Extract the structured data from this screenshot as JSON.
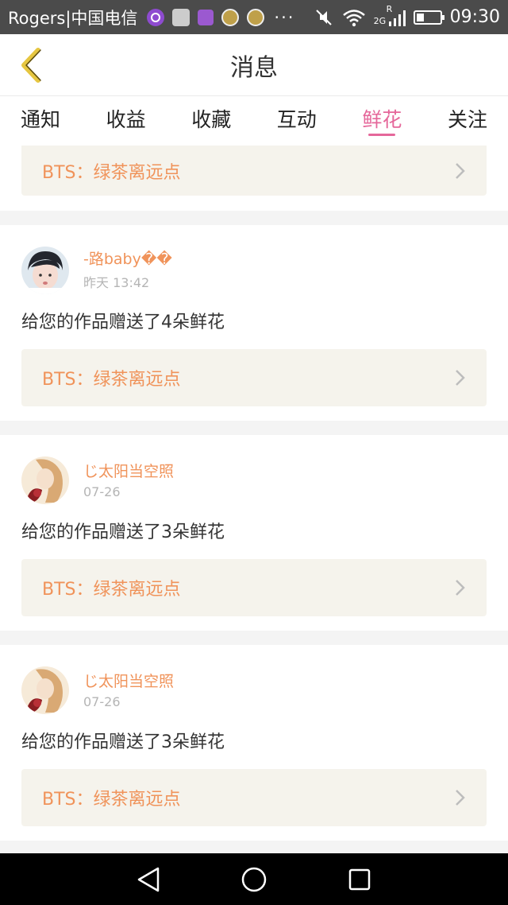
{
  "status_bar": {
    "carrier": "Rogers|中国电信",
    "dots": "···",
    "network_label": "2G",
    "roaming_label": "R",
    "time": "09:30",
    "notification_icons": [
      "music-icon",
      "photo-avatar-icon",
      "gallery-icon",
      "face-icon",
      "face-icon"
    ]
  },
  "header": {
    "title": "消息",
    "back_icon": "chevron-left-icon"
  },
  "tabs": [
    {
      "label": "通知",
      "active": false
    },
    {
      "label": "收益",
      "active": false
    },
    {
      "label": "收藏",
      "active": false
    },
    {
      "label": "互动",
      "active": false
    },
    {
      "label": "鲜花",
      "active": true
    },
    {
      "label": "关注",
      "active": false
    }
  ],
  "colors": {
    "accent": "#e5679a",
    "orange": "#f0935a",
    "status_bar": "#4b4b4b",
    "link_bg": "#f5f3ec"
  },
  "feed": {
    "partial_card": {
      "work_title": "BTS：绿茶离远点"
    },
    "items": [
      {
        "username": "-路baby��",
        "timestamp": "昨天 13:42",
        "message": "给您的作品赠送了4朵鲜花",
        "work_title": "BTS：绿茶离远点"
      },
      {
        "username": "じ太阳当空照",
        "timestamp": "07-26",
        "message": "给您的作品赠送了3朵鲜花",
        "work_title": "BTS：绿茶离远点"
      },
      {
        "username": "じ太阳当空照",
        "timestamp": "07-26",
        "message": "给您的作品赠送了3朵鲜花",
        "work_title": "BTS：绿茶离远点"
      }
    ]
  },
  "navbar": {
    "buttons": [
      "back-triangle-icon",
      "home-circle-icon",
      "recents-square-icon"
    ]
  }
}
